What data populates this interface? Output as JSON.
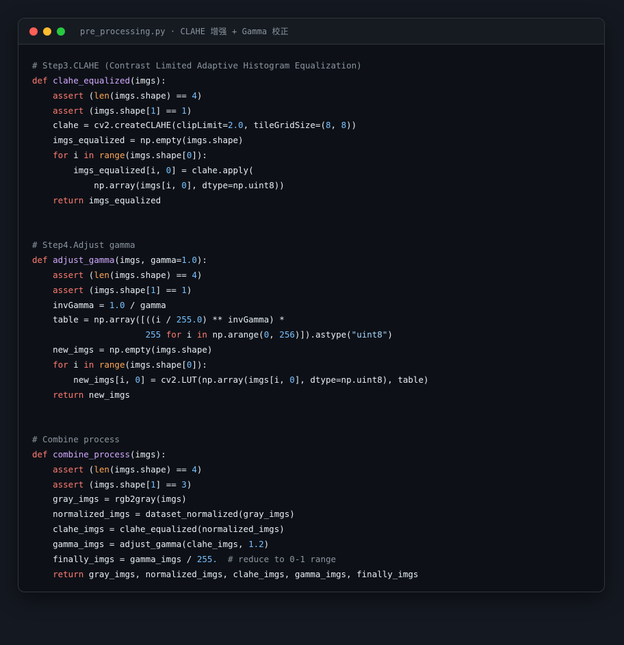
{
  "window": {
    "title": "pre_processing.py · CLAHE 增强 + Gamma 校正"
  },
  "code_lines": [
    [
      {
        "t": "# Step3.CLAHE (Contrast Limited Adaptive Histogram Equalization)",
        "c": "cm"
      }
    ],
    [
      {
        "t": "def ",
        "c": "kw"
      },
      {
        "t": "clahe_equalized",
        "c": "fn"
      },
      {
        "t": "(imgs):",
        "c": "op"
      }
    ],
    [
      {
        "t": "    ",
        "c": "op"
      },
      {
        "t": "assert ",
        "c": "kw"
      },
      {
        "t": "(",
        "c": "op"
      },
      {
        "t": "len",
        "c": "bi"
      },
      {
        "t": "(imgs.shape) == ",
        "c": "op"
      },
      {
        "t": "4",
        "c": "num"
      },
      {
        "t": ")",
        "c": "op"
      }
    ],
    [
      {
        "t": "    ",
        "c": "op"
      },
      {
        "t": "assert ",
        "c": "kw"
      },
      {
        "t": "(imgs.shape[",
        "c": "op"
      },
      {
        "t": "1",
        "c": "num"
      },
      {
        "t": "] == ",
        "c": "op"
      },
      {
        "t": "1",
        "c": "num"
      },
      {
        "t": ")",
        "c": "op"
      }
    ],
    [
      {
        "t": "    clahe = cv2.createCLAHE(clipLimit=",
        "c": "op"
      },
      {
        "t": "2.0",
        "c": "num"
      },
      {
        "t": ", tileGridSize=(",
        "c": "op"
      },
      {
        "t": "8",
        "c": "num"
      },
      {
        "t": ", ",
        "c": "op"
      },
      {
        "t": "8",
        "c": "num"
      },
      {
        "t": "))",
        "c": "op"
      }
    ],
    [
      {
        "t": "    imgs_equalized = np.empty(imgs.shape)",
        "c": "op"
      }
    ],
    [
      {
        "t": "    ",
        "c": "op"
      },
      {
        "t": "for ",
        "c": "kw"
      },
      {
        "t": "i ",
        "c": "op"
      },
      {
        "t": "in ",
        "c": "kw"
      },
      {
        "t": "range",
        "c": "bi"
      },
      {
        "t": "(imgs.shape[",
        "c": "op"
      },
      {
        "t": "0",
        "c": "num"
      },
      {
        "t": "]):",
        "c": "op"
      }
    ],
    [
      {
        "t": "        imgs_equalized[i, ",
        "c": "op"
      },
      {
        "t": "0",
        "c": "num"
      },
      {
        "t": "] = clahe.apply(",
        "c": "op"
      }
    ],
    [
      {
        "t": "            np.array(imgs[i, ",
        "c": "op"
      },
      {
        "t": "0",
        "c": "num"
      },
      {
        "t": "], dtype=np.uint8))",
        "c": "op"
      }
    ],
    [
      {
        "t": "    ",
        "c": "op"
      },
      {
        "t": "return ",
        "c": "kw"
      },
      {
        "t": "imgs_equalized",
        "c": "op"
      }
    ],
    [],
    [],
    [
      {
        "t": "# Step4.Adjust gamma",
        "c": "cm"
      }
    ],
    [
      {
        "t": "def ",
        "c": "kw"
      },
      {
        "t": "adjust_gamma",
        "c": "fn"
      },
      {
        "t": "(imgs, gamma=",
        "c": "op"
      },
      {
        "t": "1.0",
        "c": "num"
      },
      {
        "t": "):",
        "c": "op"
      }
    ],
    [
      {
        "t": "    ",
        "c": "op"
      },
      {
        "t": "assert ",
        "c": "kw"
      },
      {
        "t": "(",
        "c": "op"
      },
      {
        "t": "len",
        "c": "bi"
      },
      {
        "t": "(imgs.shape) == ",
        "c": "op"
      },
      {
        "t": "4",
        "c": "num"
      },
      {
        "t": ")",
        "c": "op"
      }
    ],
    [
      {
        "t": "    ",
        "c": "op"
      },
      {
        "t": "assert ",
        "c": "kw"
      },
      {
        "t": "(imgs.shape[",
        "c": "op"
      },
      {
        "t": "1",
        "c": "num"
      },
      {
        "t": "] == ",
        "c": "op"
      },
      {
        "t": "1",
        "c": "num"
      },
      {
        "t": ")",
        "c": "op"
      }
    ],
    [
      {
        "t": "    invGamma = ",
        "c": "op"
      },
      {
        "t": "1.0",
        "c": "num"
      },
      {
        "t": " / gamma",
        "c": "op"
      }
    ],
    [
      {
        "t": "    table = np.array([((i / ",
        "c": "op"
      },
      {
        "t": "255.0",
        "c": "num"
      },
      {
        "t": ") ** invGamma) *",
        "c": "op"
      }
    ],
    [
      {
        "t": "                      ",
        "c": "op"
      },
      {
        "t": "255 ",
        "c": "num"
      },
      {
        "t": "for ",
        "c": "kw"
      },
      {
        "t": "i ",
        "c": "op"
      },
      {
        "t": "in ",
        "c": "kw"
      },
      {
        "t": "np.arange(",
        "c": "op"
      },
      {
        "t": "0",
        "c": "num"
      },
      {
        "t": ", ",
        "c": "op"
      },
      {
        "t": "256",
        "c": "num"
      },
      {
        "t": ")]).astype(",
        "c": "op"
      },
      {
        "t": "\"uint8\"",
        "c": "str"
      },
      {
        "t": ")",
        "c": "op"
      }
    ],
    [
      {
        "t": "    new_imgs = np.empty(imgs.shape)",
        "c": "op"
      }
    ],
    [
      {
        "t": "    ",
        "c": "op"
      },
      {
        "t": "for ",
        "c": "kw"
      },
      {
        "t": "i ",
        "c": "op"
      },
      {
        "t": "in ",
        "c": "kw"
      },
      {
        "t": "range",
        "c": "bi"
      },
      {
        "t": "(imgs.shape[",
        "c": "op"
      },
      {
        "t": "0",
        "c": "num"
      },
      {
        "t": "]):",
        "c": "op"
      }
    ],
    [
      {
        "t": "        new_imgs[i, ",
        "c": "op"
      },
      {
        "t": "0",
        "c": "num"
      },
      {
        "t": "] = cv2.LUT(np.array(imgs[i, ",
        "c": "op"
      },
      {
        "t": "0",
        "c": "num"
      },
      {
        "t": "], dtype=np.uint8), table)",
        "c": "op"
      }
    ],
    [
      {
        "t": "    ",
        "c": "op"
      },
      {
        "t": "return ",
        "c": "kw"
      },
      {
        "t": "new_imgs",
        "c": "op"
      }
    ],
    [],
    [],
    [
      {
        "t": "# Combine process",
        "c": "cm"
      }
    ],
    [
      {
        "t": "def ",
        "c": "kw"
      },
      {
        "t": "combine_process",
        "c": "fn"
      },
      {
        "t": "(imgs):",
        "c": "op"
      }
    ],
    [
      {
        "t": "    ",
        "c": "op"
      },
      {
        "t": "assert ",
        "c": "kw"
      },
      {
        "t": "(",
        "c": "op"
      },
      {
        "t": "len",
        "c": "bi"
      },
      {
        "t": "(imgs.shape) == ",
        "c": "op"
      },
      {
        "t": "4",
        "c": "num"
      },
      {
        "t": ")",
        "c": "op"
      }
    ],
    [
      {
        "t": "    ",
        "c": "op"
      },
      {
        "t": "assert ",
        "c": "kw"
      },
      {
        "t": "(imgs.shape[",
        "c": "op"
      },
      {
        "t": "1",
        "c": "num"
      },
      {
        "t": "] == ",
        "c": "op"
      },
      {
        "t": "3",
        "c": "num"
      },
      {
        "t": ")",
        "c": "op"
      }
    ],
    [
      {
        "t": "    gray_imgs = rgb2gray(imgs)",
        "c": "op"
      }
    ],
    [
      {
        "t": "    normalized_imgs = dataset_normalized(gray_imgs)",
        "c": "op"
      }
    ],
    [
      {
        "t": "    clahe_imgs = clahe_equalized(normalized_imgs)",
        "c": "op"
      }
    ],
    [
      {
        "t": "    gamma_imgs = adjust_gamma(clahe_imgs, ",
        "c": "op"
      },
      {
        "t": "1.2",
        "c": "num"
      },
      {
        "t": ")",
        "c": "op"
      }
    ],
    [
      {
        "t": "    finally_imgs = gamma_imgs / ",
        "c": "op"
      },
      {
        "t": "255.",
        "c": "num"
      },
      {
        "t": "  # reduce to 0-1 range",
        "c": "cm"
      }
    ],
    [
      {
        "t": "    ",
        "c": "op"
      },
      {
        "t": "return ",
        "c": "kw"
      },
      {
        "t": "gray_imgs, normalized_imgs, clahe_imgs, gamma_imgs, finally_imgs",
        "c": "op"
      }
    ]
  ]
}
